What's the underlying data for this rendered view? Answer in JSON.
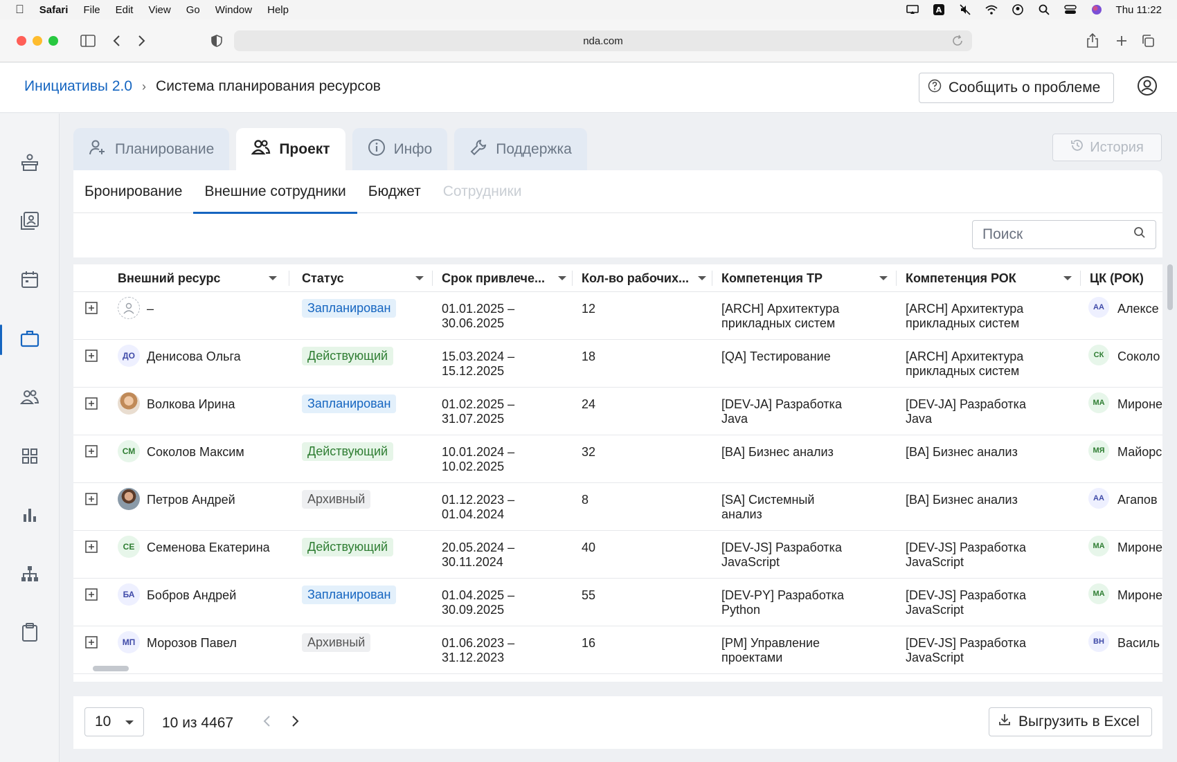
{
  "menubar": {
    "app": "Safari",
    "items": [
      "File",
      "Edit",
      "View",
      "Go",
      "Window",
      "Help"
    ],
    "clock": "Thu 11:22"
  },
  "browser": {
    "url": "nda.com"
  },
  "header": {
    "crumb_root": "Инициативы 2.0",
    "crumb_current": "Система планирования ресурсов",
    "report_label": "Сообщить о проблеме"
  },
  "tabs": [
    {
      "label": "Планирование",
      "icon": "person-add-icon"
    },
    {
      "label": "Проект",
      "icon": "people-icon",
      "active": true
    },
    {
      "label": "Инфо",
      "icon": "info-icon"
    },
    {
      "label": "Поддержка",
      "icon": "wrench-icon"
    }
  ],
  "history_label": "История",
  "subtabs": [
    {
      "label": "Бронирование"
    },
    {
      "label": "Внешние сотрудники",
      "active": true
    },
    {
      "label": "Бюджет"
    },
    {
      "label": "Сотрудники",
      "disabled": true
    }
  ],
  "search": {
    "placeholder": "Поиск"
  },
  "table": {
    "columns": [
      "Внешний ресурс",
      "Статус",
      "Срок привлече...",
      "Кол-во рабочих...",
      "Компетенция ТР",
      "Компетенция РОК",
      "ЦК (РОК)"
    ],
    "rows": [
      {
        "avatar": "",
        "avatar_type": "empty",
        "name": "–",
        "status": "Запланирован",
        "status_type": "planned",
        "date1": "01.01.2025 –",
        "date2": "30.06.2025",
        "count": "12",
        "tr1": "[ARCH] Архитектура",
        "tr2": "прикладных систем",
        "rok1": "[ARCH] Архитектура",
        "rok2": "прикладных систем",
        "ck_initials": "АА",
        "ck_name": "Алексе"
      },
      {
        "avatar": "ДО",
        "avatar_type": "initials",
        "name": "Денисова Ольга",
        "status": "Действующий",
        "status_type": "active",
        "date1": "15.03.2024 –",
        "date2": "15.12.2025",
        "count": "18",
        "tr1": "[QA] Тестирование",
        "tr2": "",
        "rok1": "[ARCH] Архитектура",
        "rok2": "прикладных систем",
        "ck_initials": "СК",
        "ck_name": "Соколо"
      },
      {
        "avatar": "",
        "avatar_type": "photo-f",
        "name": "Волкова Ирина",
        "status": "Запланирован",
        "status_type": "planned",
        "date1": "01.02.2025 –",
        "date2": "31.07.2025",
        "count": "24",
        "tr1": "[DEV-JA] Разработка",
        "tr2": "Java",
        "rok1": "[DEV-JA] Разработка",
        "rok2": "Java",
        "ck_initials": "МА",
        "ck_name": "Мироне"
      },
      {
        "avatar": "СМ",
        "avatar_type": "green",
        "name": "Соколов Максим",
        "status": "Действующий",
        "status_type": "active",
        "date1": "10.01.2024 –",
        "date2": "10.02.2025",
        "count": "32",
        "tr1": "[BA] Бизнес анализ",
        "tr2": "",
        "rok1": "[BA] Бизнес анализ",
        "rok2": "",
        "ck_initials": "МЯ",
        "ck_name": "Майорс"
      },
      {
        "avatar": "",
        "avatar_type": "photo-m",
        "name": "Петров Андрей",
        "status": "Архивный",
        "status_type": "archived",
        "date1": "01.12.2023 –",
        "date2": "01.04.2024",
        "count": "8",
        "tr1": "[SA] Системный",
        "tr2": "анализ",
        "rok1": "[BA] Бизнес анализ",
        "rok2": "",
        "ck_initials": "АА",
        "ck_name": "Агапов"
      },
      {
        "avatar": "СЕ",
        "avatar_type": "green",
        "name": "Семенова Екатерина",
        "status": "Действующий",
        "status_type": "active",
        "date1": "20.05.2024 –",
        "date2": "30.11.2024",
        "count": "40",
        "tr1": "[DEV-JS] Разработка",
        "tr2": "JavaScript",
        "rok1": "[DEV-JS] Разработка",
        "rok2": "JavaScript",
        "ck_initials": "МА",
        "ck_name": "Мироне"
      },
      {
        "avatar": "БА",
        "avatar_type": "initials",
        "name": "Бобров Андрей",
        "status": "Запланирован",
        "status_type": "planned",
        "date1": "01.04.2025 –",
        "date2": "30.09.2025",
        "count": "55",
        "tr1": "[DEV-PY] Разработка",
        "tr2": "Python",
        "rok1": "[DEV-JS] Разработка",
        "rok2": "JavaScript",
        "ck_initials": "МА",
        "ck_name": "Мироне"
      },
      {
        "avatar": "МП",
        "avatar_type": "initials",
        "name": "Морозов Павел",
        "status": "Архивный",
        "status_type": "archived",
        "date1": "01.06.2023 –",
        "date2": "31.12.2023",
        "count": "16",
        "tr1": "[PM] Управление",
        "tr2": "проектами",
        "rok1": "[DEV-JS] Разработка",
        "rok2": "JavaScript",
        "ck_initials": "ВН",
        "ck_name": "Василь"
      }
    ]
  },
  "footer": {
    "page_size": "10",
    "page_info": "10 из 4467",
    "export_label": "Выгрузить в Excel"
  },
  "colors": {
    "accent": "#1565c0",
    "active_green": "#2e7d32"
  }
}
